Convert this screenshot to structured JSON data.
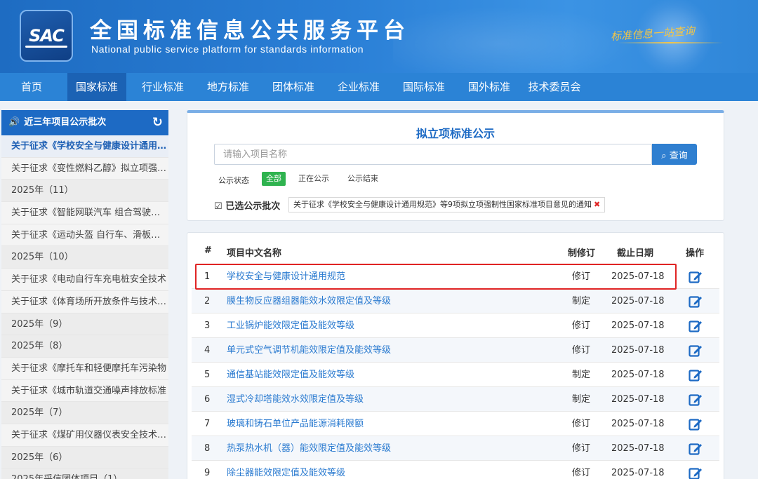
{
  "header": {
    "logo_text": "SAC",
    "title": "全国标准信息公共服务平台",
    "subtitle": "National public service platform  for standards information",
    "slogan": "标准信息一站查询",
    "accent_color": "#2b83d6"
  },
  "nav": {
    "items": [
      "首页",
      "国家标准",
      "行业标准",
      "地方标准",
      "团体标准",
      "企业标准",
      "国际标准",
      "国外标准",
      "技术委员会"
    ],
    "active": "国家标准"
  },
  "sidebar": {
    "title": "近三年项目公示批次",
    "items": [
      {
        "label": "关于征求《学校安全与健康设计通用规范》",
        "type": "item",
        "active": true
      },
      {
        "label": "关于征求《变性燃料乙醇》拟立项强制性",
        "type": "item"
      },
      {
        "label": "2025年（11）",
        "type": "year"
      },
      {
        "label": "关于征求《智能网联汽车 组合驾驶辅助",
        "type": "item"
      },
      {
        "label": "关于征求《运动头盔 自行车、滑板、轮滑",
        "type": "item"
      },
      {
        "label": "2025年（10）",
        "type": "year"
      },
      {
        "label": "关于征求《电动自行车充电桩安全技术",
        "type": "item"
      },
      {
        "label": "关于征求《体育场所开放条件与技术要求",
        "type": "item"
      },
      {
        "label": "2025年（9）",
        "type": "year"
      },
      {
        "label": "2025年（8）",
        "type": "year"
      },
      {
        "label": "关于征求《摩托车和轻便摩托车污染物",
        "type": "item"
      },
      {
        "label": "关于征求《城市轨道交通噪声排放标准",
        "type": "item"
      },
      {
        "label": "2025年（7）",
        "type": "year"
      },
      {
        "label": "关于征求《煤矿用仪器仪表安全技术要求",
        "type": "item"
      },
      {
        "label": "2025年（6）",
        "type": "year"
      },
      {
        "label": "2025年采信团体项目（1）",
        "type": "year"
      }
    ]
  },
  "search": {
    "title": "拟立项标准公示",
    "placeholder": "请输入项目名称",
    "button": "查询",
    "status_label": "公示状态",
    "filters": [
      "全部",
      "正在公示",
      "公示结束"
    ],
    "active_filter": "全部",
    "selected_label": "已选公示批次",
    "selected_tag": "关于征求《学校安全与健康设计通用规范》等9项拟立项强制性国家标准项目意见的通知"
  },
  "table": {
    "headers": {
      "num": "#",
      "name": "项目中文名称",
      "type": "制修订",
      "deadline": "截止日期",
      "op": "操作"
    },
    "rows": [
      {
        "num": "1",
        "name": "学校安全与健康设计通用规范",
        "type": "修订",
        "deadline": "2025-07-18"
      },
      {
        "num": "2",
        "name": "膜生物反应器组器能效水效限定值及等级",
        "type": "制定",
        "deadline": "2025-07-18"
      },
      {
        "num": "3",
        "name": "工业锅炉能效限定值及能效等级",
        "type": "修订",
        "deadline": "2025-07-18"
      },
      {
        "num": "4",
        "name": "单元式空气调节机能效限定值及能效等级",
        "type": "修订",
        "deadline": "2025-07-18"
      },
      {
        "num": "5",
        "name": "通信基站能效限定值及能效等级",
        "type": "制定",
        "deadline": "2025-07-18"
      },
      {
        "num": "6",
        "name": "湿式冷却塔能效水效限定值及等级",
        "type": "制定",
        "deadline": "2025-07-18"
      },
      {
        "num": "7",
        "name": "玻璃和铸石单位产品能源消耗限额",
        "type": "修订",
        "deadline": "2025-07-18"
      },
      {
        "num": "8",
        "name": "热泵热水机（器）能效限定值及能效等级",
        "type": "修订",
        "deadline": "2025-07-18"
      },
      {
        "num": "9",
        "name": "除尘器能效限定值及能效等级",
        "type": "修订",
        "deadline": "2025-07-18"
      }
    ]
  }
}
